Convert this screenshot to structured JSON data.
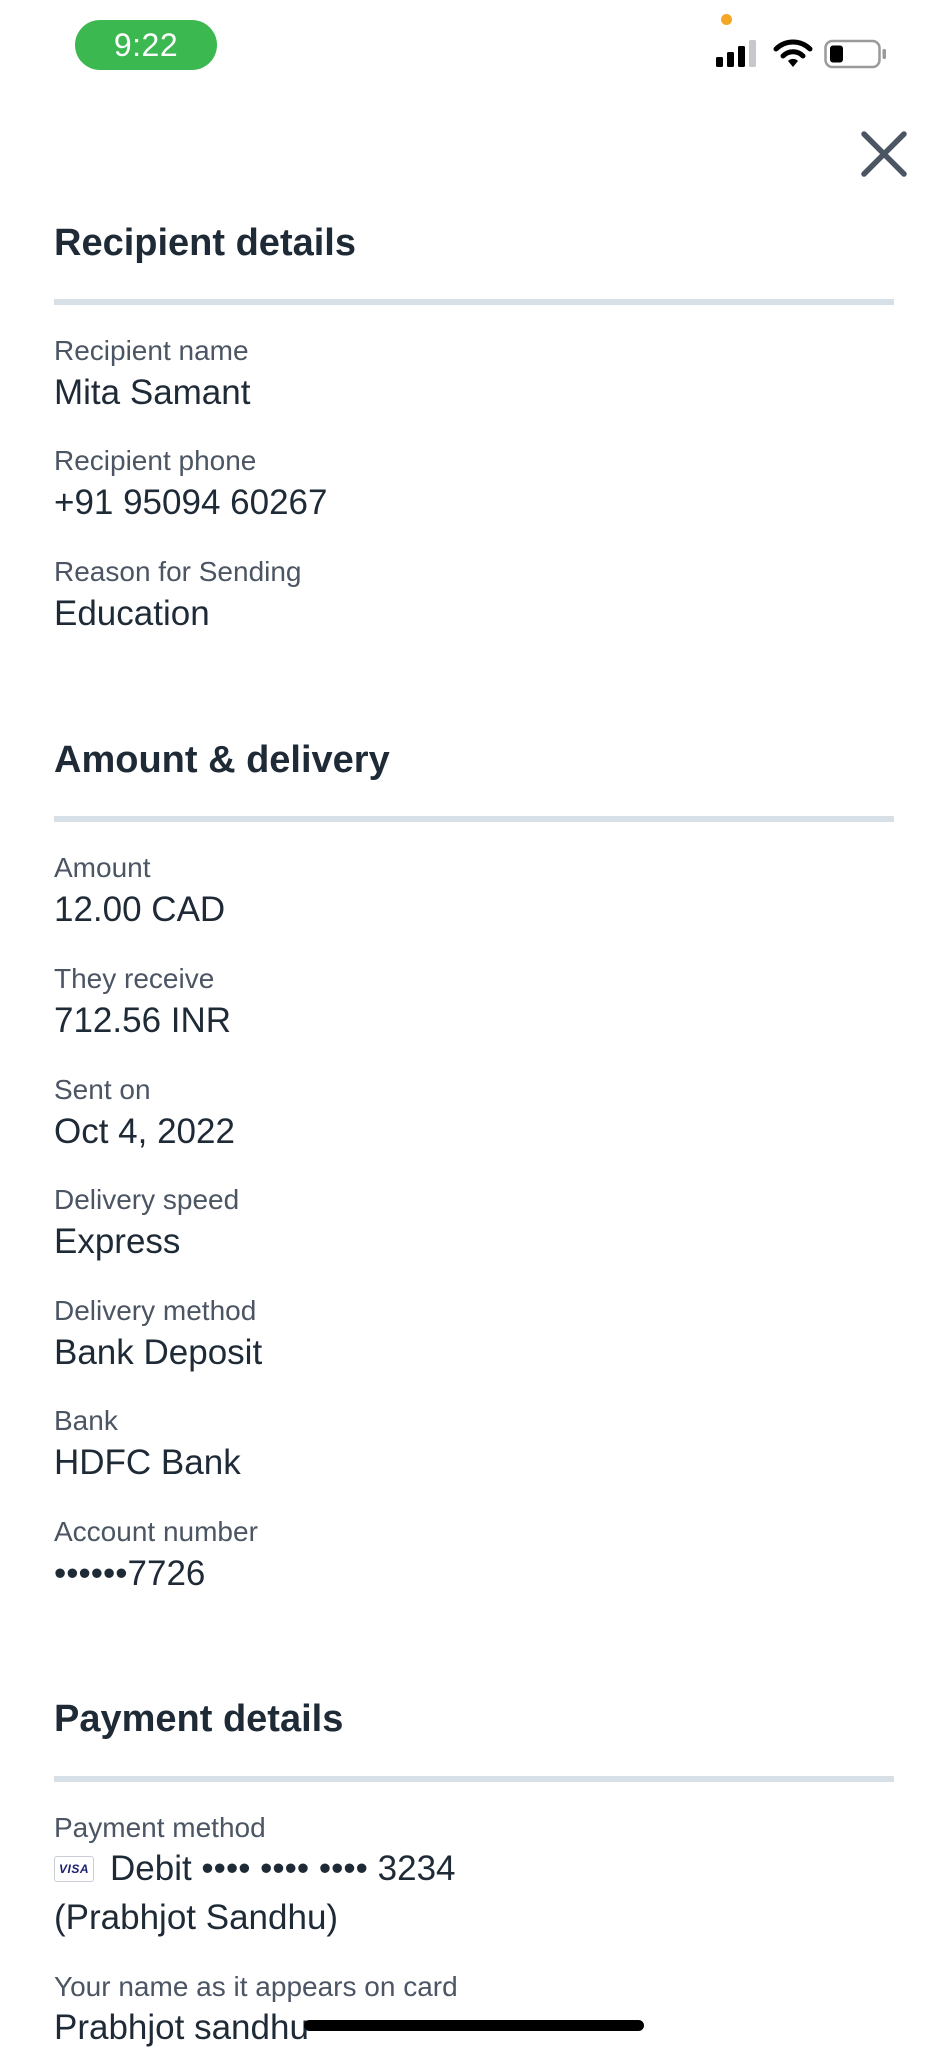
{
  "status_bar": {
    "time": "9:22",
    "icons": [
      "signal-icon",
      "wifi-icon",
      "battery-icon"
    ],
    "time_pill_color": "#3bb84f",
    "privacy_dot_color": "#f5a623"
  },
  "close_icon": "close-icon",
  "recipient": {
    "title": "Recipient details",
    "fields": [
      {
        "label": "Recipient name",
        "value": "Mita Samant"
      },
      {
        "label": "Recipient phone",
        "value": "+91 95094 60267"
      },
      {
        "label": "Reason for Sending",
        "value": "Education"
      }
    ]
  },
  "amount": {
    "title": "Amount & delivery",
    "fields": [
      {
        "label": "Amount",
        "value": "12.00 CAD"
      },
      {
        "label": "They receive",
        "value": "712.56 INR"
      },
      {
        "label": "Sent on",
        "value": "Oct 4, 2022"
      },
      {
        "label": "Delivery speed",
        "value": "Express"
      },
      {
        "label": "Delivery method",
        "value": "Bank Deposit"
      },
      {
        "label": "Bank",
        "value": "HDFC Bank"
      },
      {
        "label": "Account number",
        "value": "••••••7726"
      }
    ]
  },
  "payment": {
    "title": "Payment details",
    "method_label": "Payment method",
    "card_brand": "VISA",
    "card_line": "Debit •••• •••• •••• 3234",
    "card_holder_line": "(Prabhjot Sandhu)",
    "name_label": "Your name as it appears on card",
    "name_value": "Prabhjot sandhu"
  }
}
